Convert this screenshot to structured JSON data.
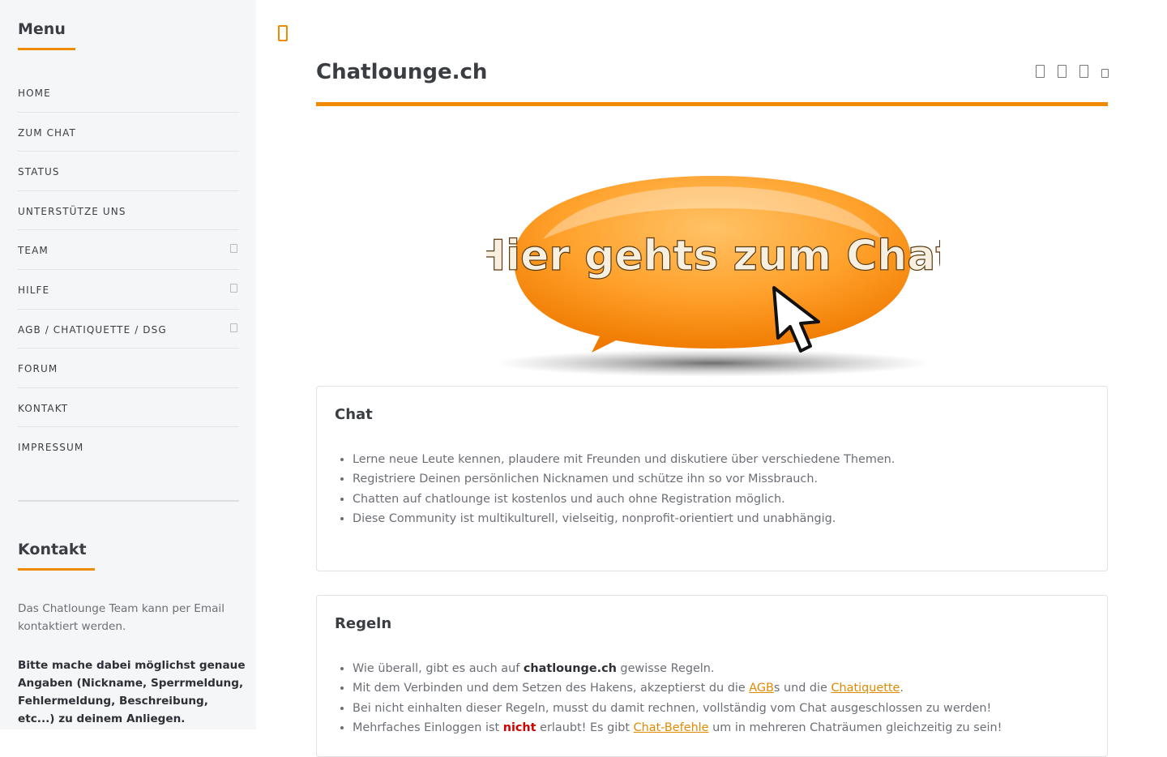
{
  "sidebar": {
    "menu_title": "Menu",
    "menu_items": [
      {
        "label": "HOME",
        "has_submenu": false
      },
      {
        "label": "ZUM CHAT",
        "has_submenu": false
      },
      {
        "label": "STATUS",
        "has_submenu": false
      },
      {
        "label": "UNTERSTÜTZE UNS",
        "has_submenu": false
      },
      {
        "label": "TEAM",
        "has_submenu": true
      },
      {
        "label": "HILFE",
        "has_submenu": true
      },
      {
        "label": "AGB / CHATIQUETTE / DSG",
        "has_submenu": true
      },
      {
        "label": "FORUM",
        "has_submenu": false
      },
      {
        "label": "KONTAKT",
        "has_submenu": false
      },
      {
        "label": "IMPRESSUM",
        "has_submenu": false
      }
    ],
    "contact_title": "Kontakt",
    "contact_text": "Das Chatlounge Team kann per Email kontaktiert werden.",
    "contact_bold": "Bitte mache dabei möglichst genaue Angaben (Nickname, Sperrmeldung, Fehlermeldung, Beschreibung, etc...) zu deinem Anliegen."
  },
  "header": {
    "title": "Chatlounge.ch",
    "icons": [
      "share-icon",
      "print-icon",
      "email-icon",
      "bookmark-icon"
    ],
    "menu_icon": "hamburger-icon"
  },
  "banner": {
    "text": "Hier gehts zum Chat",
    "icon": "cursor-arrow-icon"
  },
  "cards": {
    "chat": {
      "title": "Chat",
      "items": [
        "Lerne neue Leute kennen, plaudere mit Freunden und diskutiere über verschiedene Themen.",
        "Registriere Deinen persönlichen Nicknamen und schütze ihn so vor Missbrauch.",
        "Chatten auf chatlounge ist kostenlos und auch ohne Registration möglich.",
        "Diese Community ist multikulturell, vielseitig, nonprofit-orientiert und unabhängig."
      ]
    },
    "rules": {
      "title": "Regeln",
      "item1_pre": "Wie überall, gibt es auch auf ",
      "item1_bold": "chatlounge.ch",
      "item1_post": " gewisse Regeln.",
      "item2_pre": "Mit dem Verbinden und dem Setzen des Hakens, akzeptierst du die ",
      "item2_link1": "AGB",
      "item2_mid": "s und die ",
      "item2_link2": "Chatiquette",
      "item2_post": ".",
      "item3": "Bei nicht einhalten dieser Regeln, musst du damit rechnen, vollständig vom Chat ausgeschlossen zu werden!",
      "item4_pre": "Mehrfaches Einloggen ist ",
      "item4_red": "nicht",
      "item4_mid": " erlaubt! Es gibt ",
      "item4_link": "Chat-Befehle",
      "item4_post": " um in mehreren Chaträumen gleichzeitig zu sein!"
    }
  },
  "colors": {
    "accent": "#f08a00",
    "sidebar_bg": "#f5f6f8",
    "link": "#e08a00",
    "warning": "#d40000"
  }
}
